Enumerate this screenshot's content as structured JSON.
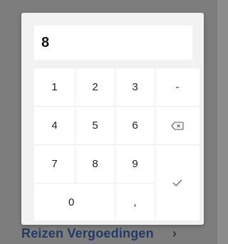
{
  "display": {
    "value": "8"
  },
  "keys": {
    "k1": "1",
    "k2": "2",
    "k3": "3",
    "minus": "-",
    "k4": "4",
    "k5": "5",
    "k6": "6",
    "k7": "7",
    "k8": "8",
    "k9": "9",
    "k0": "0",
    "comma": ","
  },
  "icons": {
    "backspace": "backspace-icon",
    "done": "checkmark-icon"
  },
  "background": {
    "partial_text": "Reizen  Vergoedingen"
  }
}
